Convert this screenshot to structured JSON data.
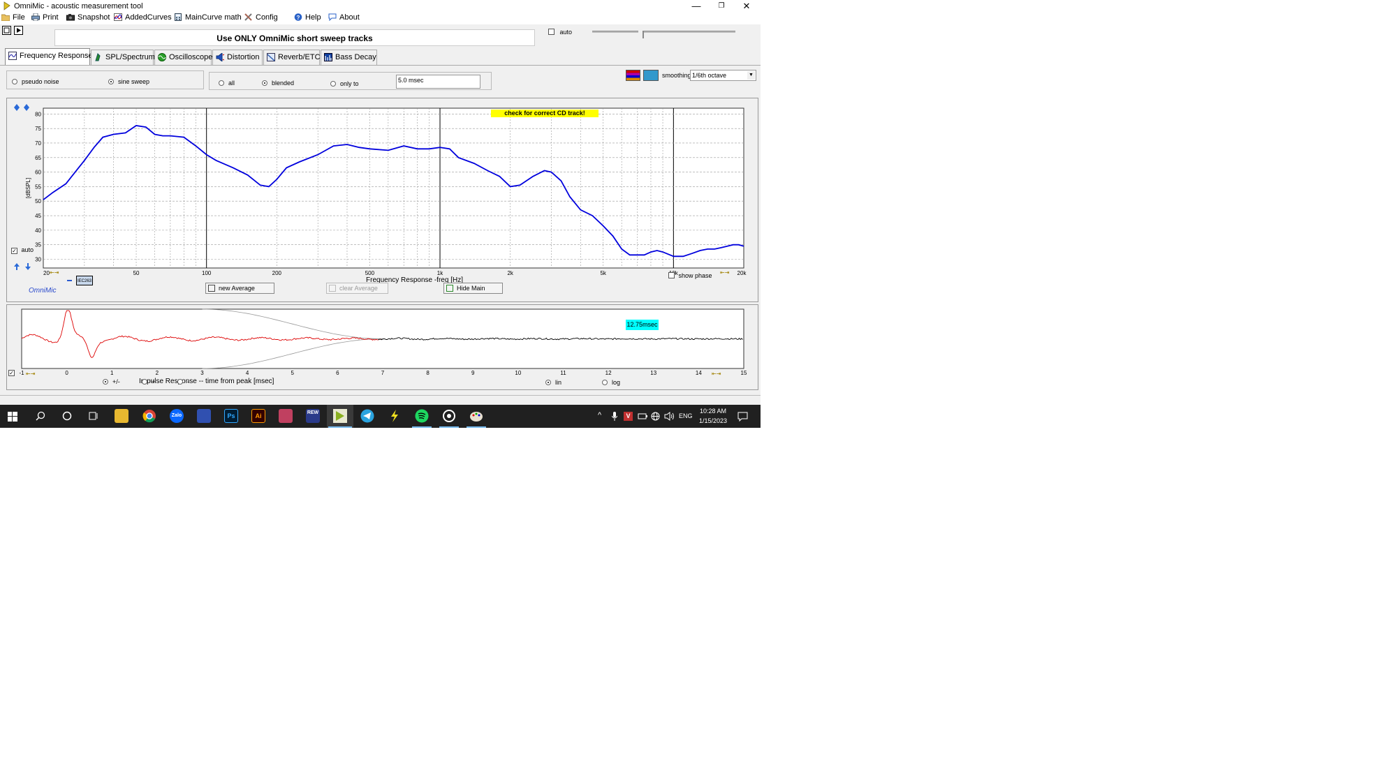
{
  "window": {
    "title": "OmniMic - acoustic measurement tool",
    "minimize": "—",
    "restore": "❐",
    "close": "✕"
  },
  "menu": {
    "items": [
      {
        "label": "File",
        "icon": "folder-icon"
      },
      {
        "label": "Print",
        "icon": "printer-icon"
      },
      {
        "label": "Snapshot",
        "icon": "camera-icon"
      },
      {
        "label": "AddedCurves",
        "icon": "curves-icon"
      },
      {
        "label": "MainCurve math",
        "icon": "calculator-icon"
      },
      {
        "label": "Config",
        "icon": "tools-icon"
      },
      {
        "label": "Help",
        "icon": "help-icon"
      },
      {
        "label": "About",
        "icon": "speech-bubble-icon"
      }
    ]
  },
  "banner": {
    "text": "Use ONLY OmniMic short sweep tracks"
  },
  "top_right": {
    "auto_label": "auto",
    "auto_checked": false
  },
  "tabs": [
    {
      "label": "Frequency Response",
      "active": true,
      "color": "#3a6ea5"
    },
    {
      "label": "SPL/Spectrum",
      "active": false,
      "color": "#2a8a2a"
    },
    {
      "label": "Oscilloscope",
      "active": false,
      "color": "#28a028"
    },
    {
      "label": "Distortion",
      "active": false,
      "color": "#2050c0"
    },
    {
      "label": "Reverb/ETC",
      "active": false,
      "color": "#3060b0"
    },
    {
      "label": "Bass Decay",
      "active": false,
      "color": "#1040a0"
    }
  ],
  "signal": {
    "pseudo_noise": "pseudo noise",
    "sine_sweep": "sine sweep",
    "selected": "sine sweep"
  },
  "window_mode": {
    "all": "all",
    "blended": "blended",
    "only_to": "only to",
    "selected": "blended",
    "time_value": "5.0 msec"
  },
  "smoothing": {
    "label": "smoothing",
    "value": "1/6th octave"
  },
  "freq_panel": {
    "warning": "check for correct CD track!",
    "auto_label": "auto",
    "auto_checked": true,
    "legend_label": "IEC263",
    "brand": "OmniMic",
    "show_phase": "show phase",
    "new_average": "new Average",
    "clear_average": "clear Average",
    "hide_main": "Hide Main"
  },
  "impulse_panel": {
    "cursor_label": "12.75msec",
    "polarity": {
      "plus_minus": "+/-",
      "plus": "+",
      "minus": "-",
      "selected": "+/-"
    },
    "scale": {
      "lin": "lin",
      "log": "log",
      "selected": "lin"
    }
  },
  "taskbar": {
    "lang": "ENG",
    "time": "10:28 AM",
    "date": "1/15/2023",
    "apps": [
      "start-icon",
      "search-icon",
      "cortana-icon",
      "taskview-icon",
      "explorer-icon",
      "chrome-icon",
      "zalo-icon",
      "app-icon",
      "photoshop-icon",
      "illustrator-icon",
      "app2-icon",
      "rew-icon",
      "omnimic-icon",
      "telegram-icon",
      "flash-icon",
      "spotify-icon",
      "app3-icon",
      "paint-icon"
    ]
  },
  "chart_data": [
    {
      "type": "line",
      "title": "",
      "xlabel": "Frequency Response -freq [Hz]",
      "ylabel": "[dBSPL]",
      "xscale": "log",
      "xlim": [
        20,
        20000
      ],
      "ylim": [
        27,
        82
      ],
      "x_ticks": [
        20,
        50,
        100,
        200,
        500,
        1000,
        2000,
        5000,
        10000,
        20000
      ],
      "x_tick_labels": [
        "20",
        "50",
        "100",
        "200",
        "500",
        "1k",
        "2k",
        "5k",
        "10k",
        "20k"
      ],
      "y_ticks": [
        30,
        35,
        40,
        45,
        50,
        55,
        60,
        65,
        70,
        75,
        80
      ],
      "grid": true,
      "series": [
        {
          "name": "",
          "color": "#0000dd",
          "x": [
            20,
            22,
            25,
            28,
            30,
            33,
            36,
            40,
            45,
            50,
            55,
            60,
            65,
            70,
            80,
            90,
            100,
            110,
            130,
            150,
            170,
            185,
            200,
            220,
            250,
            300,
            350,
            400,
            450,
            500,
            600,
            700,
            800,
            900,
            1000,
            1100,
            1200,
            1400,
            1600,
            1800,
            2000,
            2200,
            2500,
            2800,
            3000,
            3300,
            3600,
            4000,
            4500,
            5000,
            5500,
            6000,
            6500,
            7000,
            7500,
            8000,
            8500,
            9000,
            10000,
            11000,
            12000,
            13000,
            14000,
            15000,
            16000,
            17000,
            18000,
            19000,
            20000
          ],
          "y": [
            50.5,
            53,
            56,
            61,
            64,
            68.5,
            72,
            73,
            73.5,
            76,
            75.5,
            73,
            72.5,
            72.5,
            72,
            69,
            66,
            64,
            61.5,
            59,
            55.5,
            55,
            57.5,
            61.5,
            63.5,
            66,
            69,
            69.5,
            68.5,
            68,
            67.5,
            69,
            68,
            68,
            68.5,
            68,
            65,
            63,
            60.5,
            58.5,
            55,
            55.5,
            58.5,
            60.5,
            60,
            57,
            51.5,
            47,
            45,
            41.5,
            38,
            33.5,
            31.5,
            31.5,
            31.5,
            32.5,
            33,
            32.5,
            31,
            31,
            32,
            33,
            33.5,
            33.5,
            34,
            34.5,
            35,
            35,
            34.5
          ]
        }
      ]
    },
    {
      "type": "line",
      "title": "",
      "xlabel": "Impulse Response  -- time from peak [msec]",
      "ylabel": "",
      "xlim": [
        -1,
        15
      ],
      "x_ticks": [
        -1,
        0,
        1,
        2,
        3,
        4,
        5,
        6,
        7,
        8,
        9,
        10,
        11,
        12,
        13,
        14,
        15
      ],
      "ylim": [
        -1,
        1
      ],
      "grid": false,
      "series": [
        {
          "name": "",
          "color": "#dd0000",
          "note_range_ms": [
            -1,
            7
          ]
        },
        {
          "name": "",
          "color": "#000000",
          "note_range_ms": [
            7,
            15
          ]
        }
      ],
      "cursor_ms": 12.75
    }
  ]
}
